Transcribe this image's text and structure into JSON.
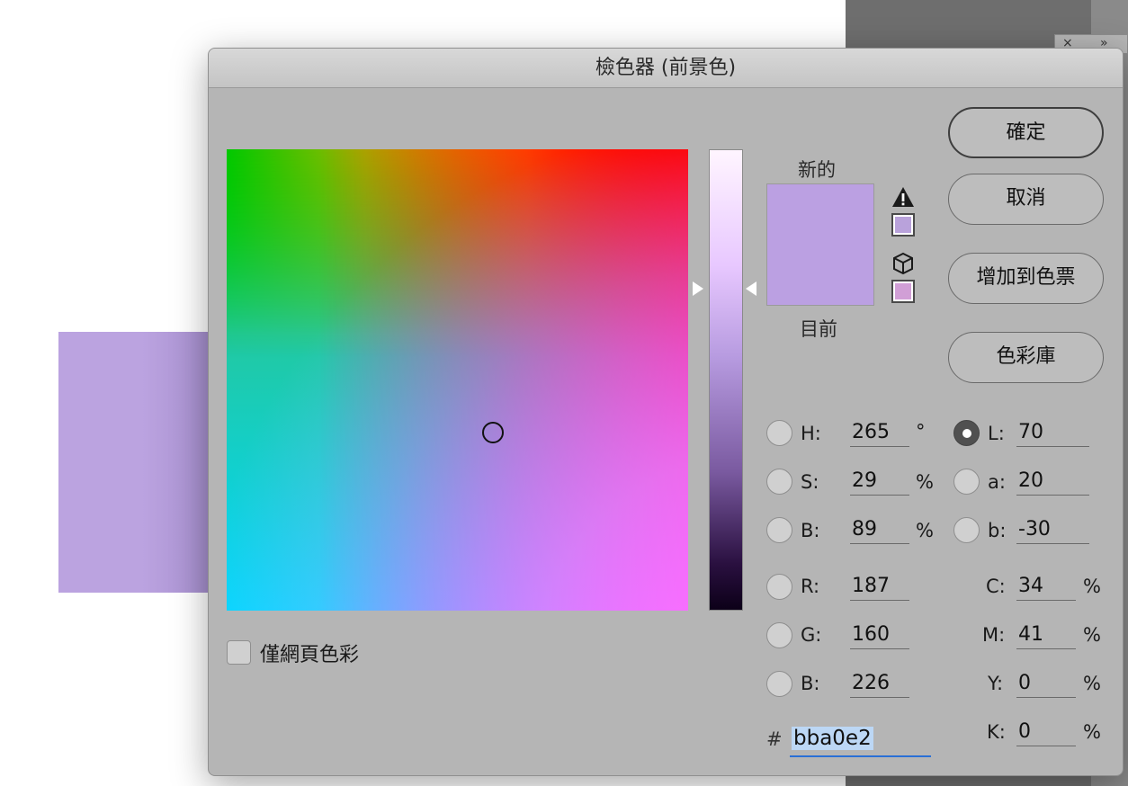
{
  "window": {
    "title": "檢色器 (前景色)"
  },
  "background": {
    "panel_icons": [
      "×",
      "»"
    ]
  },
  "colors": {
    "new": "#bba0e2",
    "current": "#bba0e2",
    "gamut_swatch": "#b9a2db",
    "web_swatch": "#d19fd6"
  },
  "preview": {
    "new_label": "新的",
    "current_label": "目前"
  },
  "buttons": {
    "ok": "確定",
    "cancel": "取消",
    "add_to_swatches": "增加到色票",
    "color_libraries": "色彩庫"
  },
  "hsb": {
    "h": {
      "label": "H:",
      "value": "265",
      "unit": "°"
    },
    "s": {
      "label": "S:",
      "value": "29",
      "unit": "%"
    },
    "b": {
      "label": "B:",
      "value": "89",
      "unit": "%"
    }
  },
  "rgb": {
    "r": {
      "label": "R:",
      "value": "187"
    },
    "g": {
      "label": "G:",
      "value": "160"
    },
    "b": {
      "label": "B:",
      "value": "226"
    }
  },
  "lab": {
    "l": {
      "label": "L:",
      "value": "70",
      "selected": true
    },
    "a": {
      "label": "a:",
      "value": "20"
    },
    "b": {
      "label": "b:",
      "value": "-30"
    }
  },
  "cmyk": {
    "c": {
      "label": "C:",
      "value": "34",
      "unit": "%"
    },
    "m": {
      "label": "M:",
      "value": "41",
      "unit": "%"
    },
    "y": {
      "label": "Y:",
      "value": "0",
      "unit": "%"
    },
    "k": {
      "label": "K:",
      "value": "0",
      "unit": "%"
    }
  },
  "hex": {
    "label": "#",
    "value": "bba0e2"
  },
  "web_only": {
    "label": "僅網頁色彩",
    "checked": false
  }
}
